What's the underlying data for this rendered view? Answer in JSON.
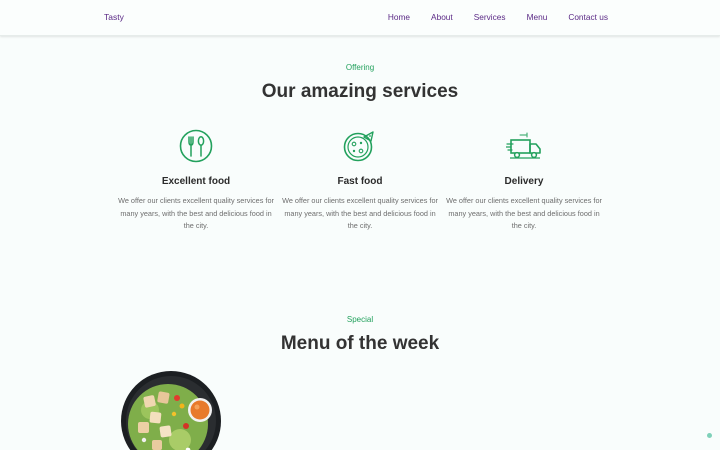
{
  "header": {
    "logo": "Tasty",
    "nav": [
      "Home",
      "About",
      "Services",
      "Menu",
      "Contact us"
    ]
  },
  "services_section": {
    "kicker": "Offering",
    "title": "Our amazing services",
    "items": [
      {
        "icon": "utensils-icon",
        "title": "Excellent food",
        "description": "We offer our clients excellent quality services for many years, with the best and delicious food in the city."
      },
      {
        "icon": "pizza-icon",
        "title": "Fast food",
        "description": "We offer our clients excellent quality services for many years, with the best and delicious food in the city."
      },
      {
        "icon": "delivery-truck-icon",
        "title": "Delivery",
        "description": "We offer our clients excellent quality services for many years, with the best and delicious food in the city."
      }
    ]
  },
  "menu_section": {
    "kicker": "Special",
    "title": "Menu of the week"
  },
  "colors": {
    "accent_green": "#23a15d",
    "nav_purple": "#5b2a86",
    "heading": "#333333",
    "background": "#f9fdfc"
  }
}
